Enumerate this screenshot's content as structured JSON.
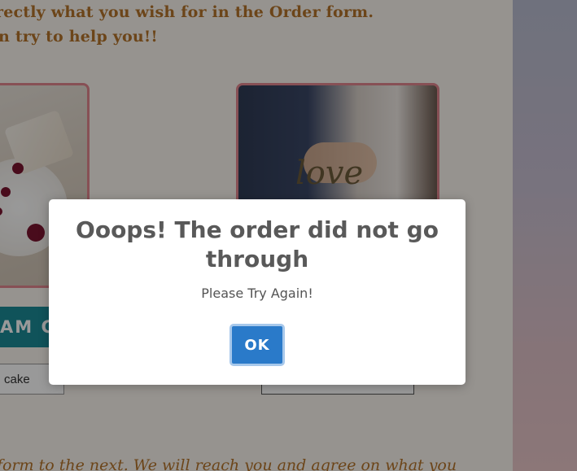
{
  "page": {
    "intro_line_1": "rectly what you wish for in the Order form.",
    "intro_line_2": "n try to help you!!",
    "cake_button_partial": "AM CA",
    "select_left_partial": "cake",
    "footer_partial": "form to the next. We will reach you and agree on what you",
    "decor_text": "love"
  },
  "modal": {
    "title": "Ooops! The order did not go through",
    "message": "Please Try Again!",
    "ok_label": "OK"
  },
  "colors": {
    "accent_text": "#b5732a",
    "card_border": "#e2868e",
    "teal_button": "#1b8a97",
    "ok_button": "#2a7ac9"
  }
}
